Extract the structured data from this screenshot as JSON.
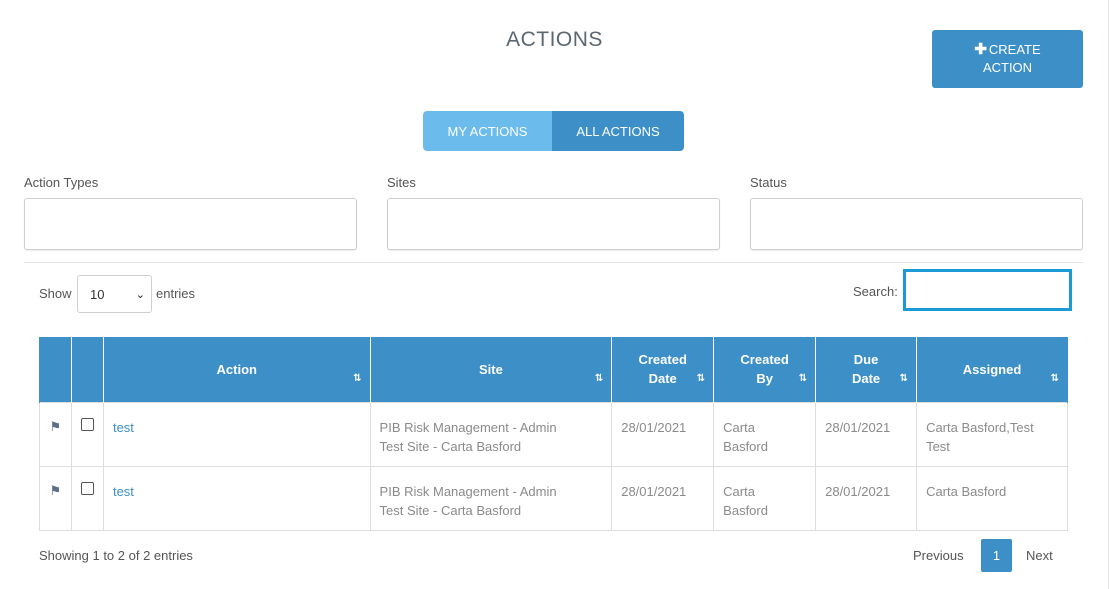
{
  "page": {
    "title": "ACTIONS"
  },
  "create_button": {
    "label_line1": "CREATE",
    "label_line2": "ACTION",
    "icon": "plus-icon"
  },
  "toggle": {
    "my_actions": "MY ACTIONS",
    "all_actions": "ALL ACTIONS"
  },
  "filters": {
    "action_types": "Action Types",
    "sites": "Sites",
    "status": "Status"
  },
  "length": {
    "show": "Show",
    "selected": "10",
    "entries": "entries"
  },
  "search": {
    "label": "Search:",
    "value": ""
  },
  "table": {
    "headers": {
      "action": "Action",
      "site": "Site",
      "created_date_1": "Created",
      "created_date_2": "Date",
      "created_by_1": "Created",
      "created_by_2": "By",
      "due_date_1": "Due",
      "due_date_2": "Date",
      "assigned": "Assigned"
    },
    "sort_icon": "sort-arrows-icon",
    "rows": [
      {
        "action": "test",
        "site_1": "PIB Risk Management - Admin",
        "site_2": "Test Site - Carta Basford",
        "created_date": "28/01/2021",
        "created_by_1": "Carta",
        "created_by_2": "Basford",
        "due_date": "28/01/2021",
        "assigned_1": "Carta Basford,Test",
        "assigned_2": "Test"
      },
      {
        "action": "test",
        "site_1": "PIB Risk Management - Admin",
        "site_2": "Test Site - Carta Basford",
        "created_date": "28/01/2021",
        "created_by_1": "Carta",
        "created_by_2": "Basford",
        "due_date": "28/01/2021",
        "assigned_1": "Carta Basford",
        "assigned_2": ""
      }
    ]
  },
  "footer": {
    "info": "Showing 1 to 2 of 2 entries",
    "previous": "Previous",
    "page": "1",
    "next": "Next"
  },
  "colors": {
    "primary": "#3d8fc7",
    "toggle_light": "#6bbcec",
    "search_border": "#1c9ad6"
  }
}
